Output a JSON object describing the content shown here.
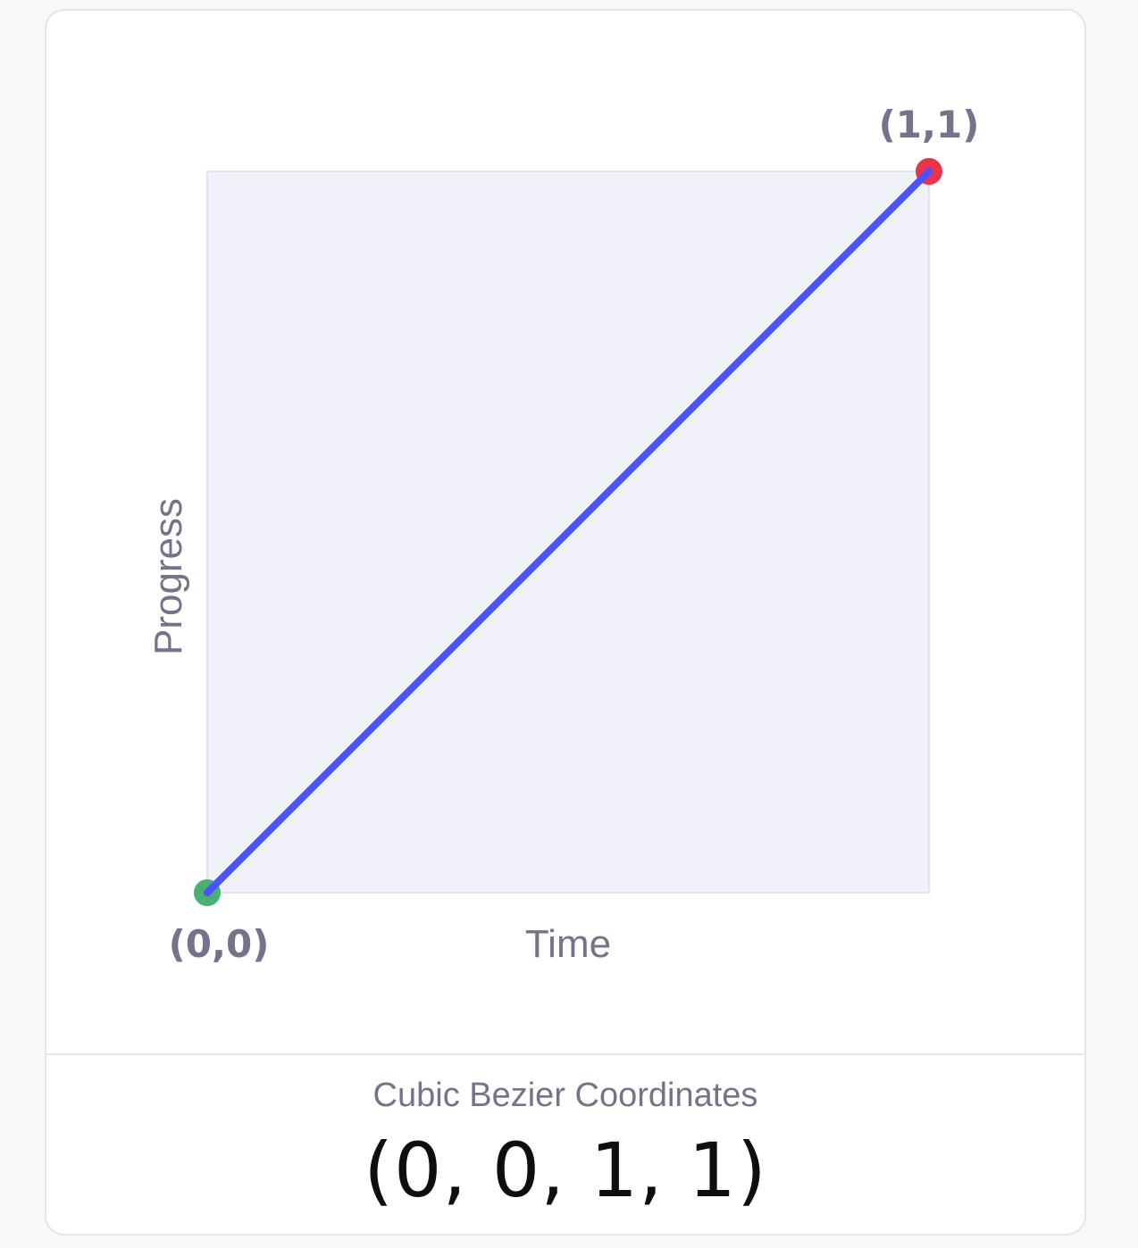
{
  "diagram": {
    "x_axis_label": "Time",
    "y_axis_label": "Progress",
    "start_point": {
      "label": "(0,0)",
      "x": 0,
      "y": 0,
      "color": "#4caf72"
    },
    "end_point": {
      "label": "(1,1)",
      "x": 1,
      "y": 1,
      "color": "#e8344a"
    },
    "curve_color": "#4c52ff",
    "plot_background": "#f0f1f9",
    "control_points": [
      0,
      0,
      1,
      1
    ]
  },
  "footer": {
    "label": "Cubic Bezier Coordinates",
    "value": "(0, 0, 1, 1)"
  }
}
